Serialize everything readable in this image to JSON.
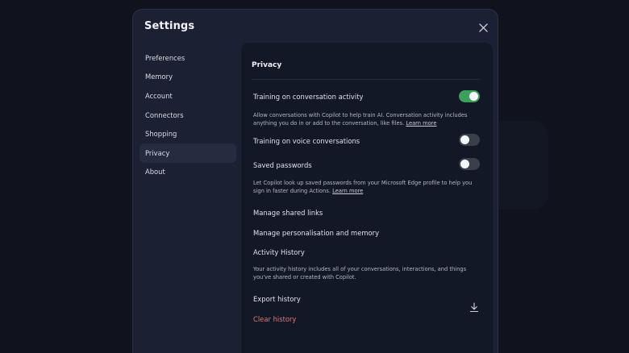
{
  "dialog": {
    "title": "Settings",
    "close_icon": "close-icon"
  },
  "sidebar": {
    "items": [
      {
        "label": "Preferences",
        "active": false
      },
      {
        "label": "Memory",
        "active": false
      },
      {
        "label": "Account",
        "active": false
      },
      {
        "label": "Connectors",
        "active": false
      },
      {
        "label": "Shopping",
        "active": false
      },
      {
        "label": "Privacy",
        "active": true
      },
      {
        "label": "About",
        "active": false
      }
    ]
  },
  "privacy": {
    "title": "Privacy",
    "training_conversation": {
      "label": "Training on conversation activity",
      "enabled": true,
      "description": "Allow conversations with Copilot to help train AI. Conversation activity includes anything you do in or add to the conversation, like files.",
      "learn_more": "Learn more"
    },
    "training_voice": {
      "label": "Training on voice conversations",
      "enabled": false
    },
    "saved_passwords": {
      "label": "Saved passwords",
      "enabled": false,
      "description": "Let Copilot look up saved passwords from your Microsoft Edge profile to help you sign in faster during Actions.",
      "learn_more": "Learn more"
    },
    "manage_shared_links": "Manage shared links",
    "manage_personalisation": "Manage personalisation and memory",
    "activity_history": {
      "title": "Activity History",
      "description": "Your activity history includes all of your conversations, interactions, and things you've shared or created with Copilot."
    },
    "export_history": "Export history",
    "export_icon": "download-icon",
    "clear_history": "Clear history"
  },
  "colors": {
    "toggle_on": "#3aa15a",
    "toggle_off": "#3a3f4c",
    "danger": "#e5766e",
    "panel_bg": "#131827",
    "dialog_bg": "#1b2133"
  }
}
